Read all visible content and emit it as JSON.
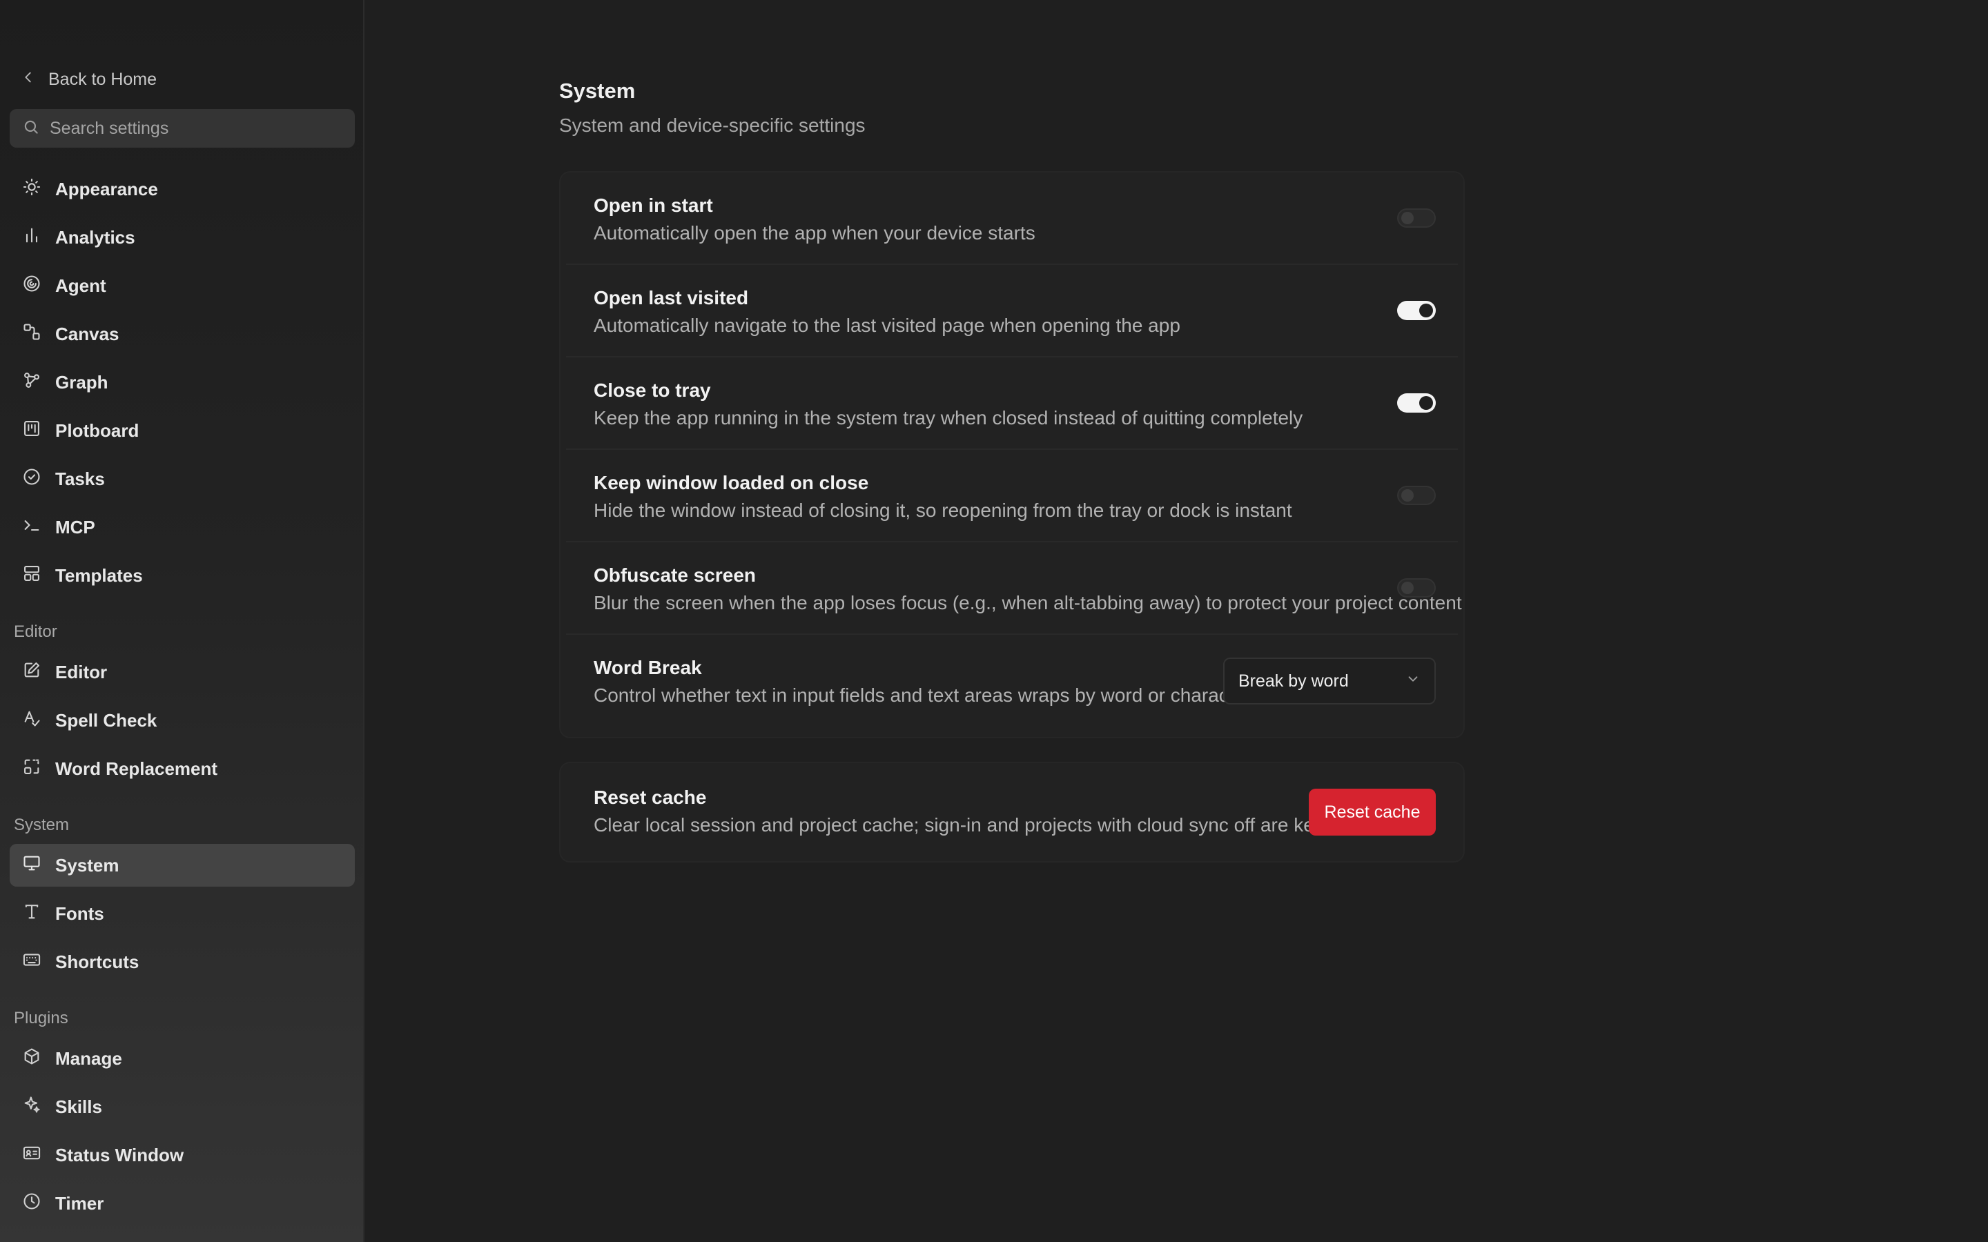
{
  "sidebar": {
    "back_label": "Back to Home",
    "search_placeholder": "Search settings",
    "general_items": [
      {
        "label": "Appearance",
        "icon": "sun-icon"
      },
      {
        "label": "Analytics",
        "icon": "bar-chart-icon"
      },
      {
        "label": "Agent",
        "icon": "spiral-icon"
      },
      {
        "label": "Canvas",
        "icon": "canvas-icon"
      },
      {
        "label": "Graph",
        "icon": "graph-icon"
      },
      {
        "label": "Plotboard",
        "icon": "kanban-icon"
      },
      {
        "label": "Tasks",
        "icon": "check-circle-icon"
      },
      {
        "label": "MCP",
        "icon": "terminal-icon"
      },
      {
        "label": "Templates",
        "icon": "layout-icon"
      }
    ],
    "editor_group": {
      "title": "Editor",
      "items": [
        {
          "label": "Editor",
          "icon": "edit-icon"
        },
        {
          "label": "Spell Check",
          "icon": "spell-check-icon"
        },
        {
          "label": "Word Replacement",
          "icon": "replace-icon"
        }
      ]
    },
    "system_group": {
      "title": "System",
      "items": [
        {
          "label": "System",
          "icon": "monitor-icon",
          "active": true
        },
        {
          "label": "Fonts",
          "icon": "type-icon"
        },
        {
          "label": "Shortcuts",
          "icon": "keyboard-icon"
        }
      ]
    },
    "plugins_group": {
      "title": "Plugins",
      "items": [
        {
          "label": "Manage",
          "icon": "package-icon"
        },
        {
          "label": "Skills",
          "icon": "sparkles-icon"
        },
        {
          "label": "Status Window",
          "icon": "id-card-icon"
        },
        {
          "label": "Timer",
          "icon": "clock-icon"
        }
      ]
    }
  },
  "main": {
    "title": "System",
    "subtitle": "System and device-specific settings",
    "settings": [
      {
        "title": "Open in start",
        "description": "Automatically open the app when your device starts",
        "control": "toggle",
        "enabled": false
      },
      {
        "title": "Open last visited",
        "description": "Automatically navigate to the last visited page when opening the app",
        "control": "toggle",
        "enabled": true
      },
      {
        "title": "Close to tray",
        "description": "Keep the app running in the system tray when closed instead of quitting completely",
        "control": "toggle",
        "enabled": true
      },
      {
        "title": "Keep window loaded on close",
        "description": "Hide the window instead of closing it, so reopening from the tray or dock is instant",
        "control": "toggle",
        "enabled": false
      },
      {
        "title": "Obfuscate screen",
        "description": "Blur the screen when the app loses focus (e.g., when alt-tabbing away) to protect your project content",
        "control": "toggle",
        "enabled": false
      },
      {
        "title": "Word Break",
        "description": "Control whether text in input fields and text areas wraps by word or character",
        "control": "select",
        "value": "Break by word"
      }
    ],
    "reset": {
      "title": "Reset cache",
      "description": "Clear local session and project cache; sign-in and projects with cloud sync off are kept.",
      "button_label": "Reset cache",
      "button_color": "#d6232f"
    }
  }
}
